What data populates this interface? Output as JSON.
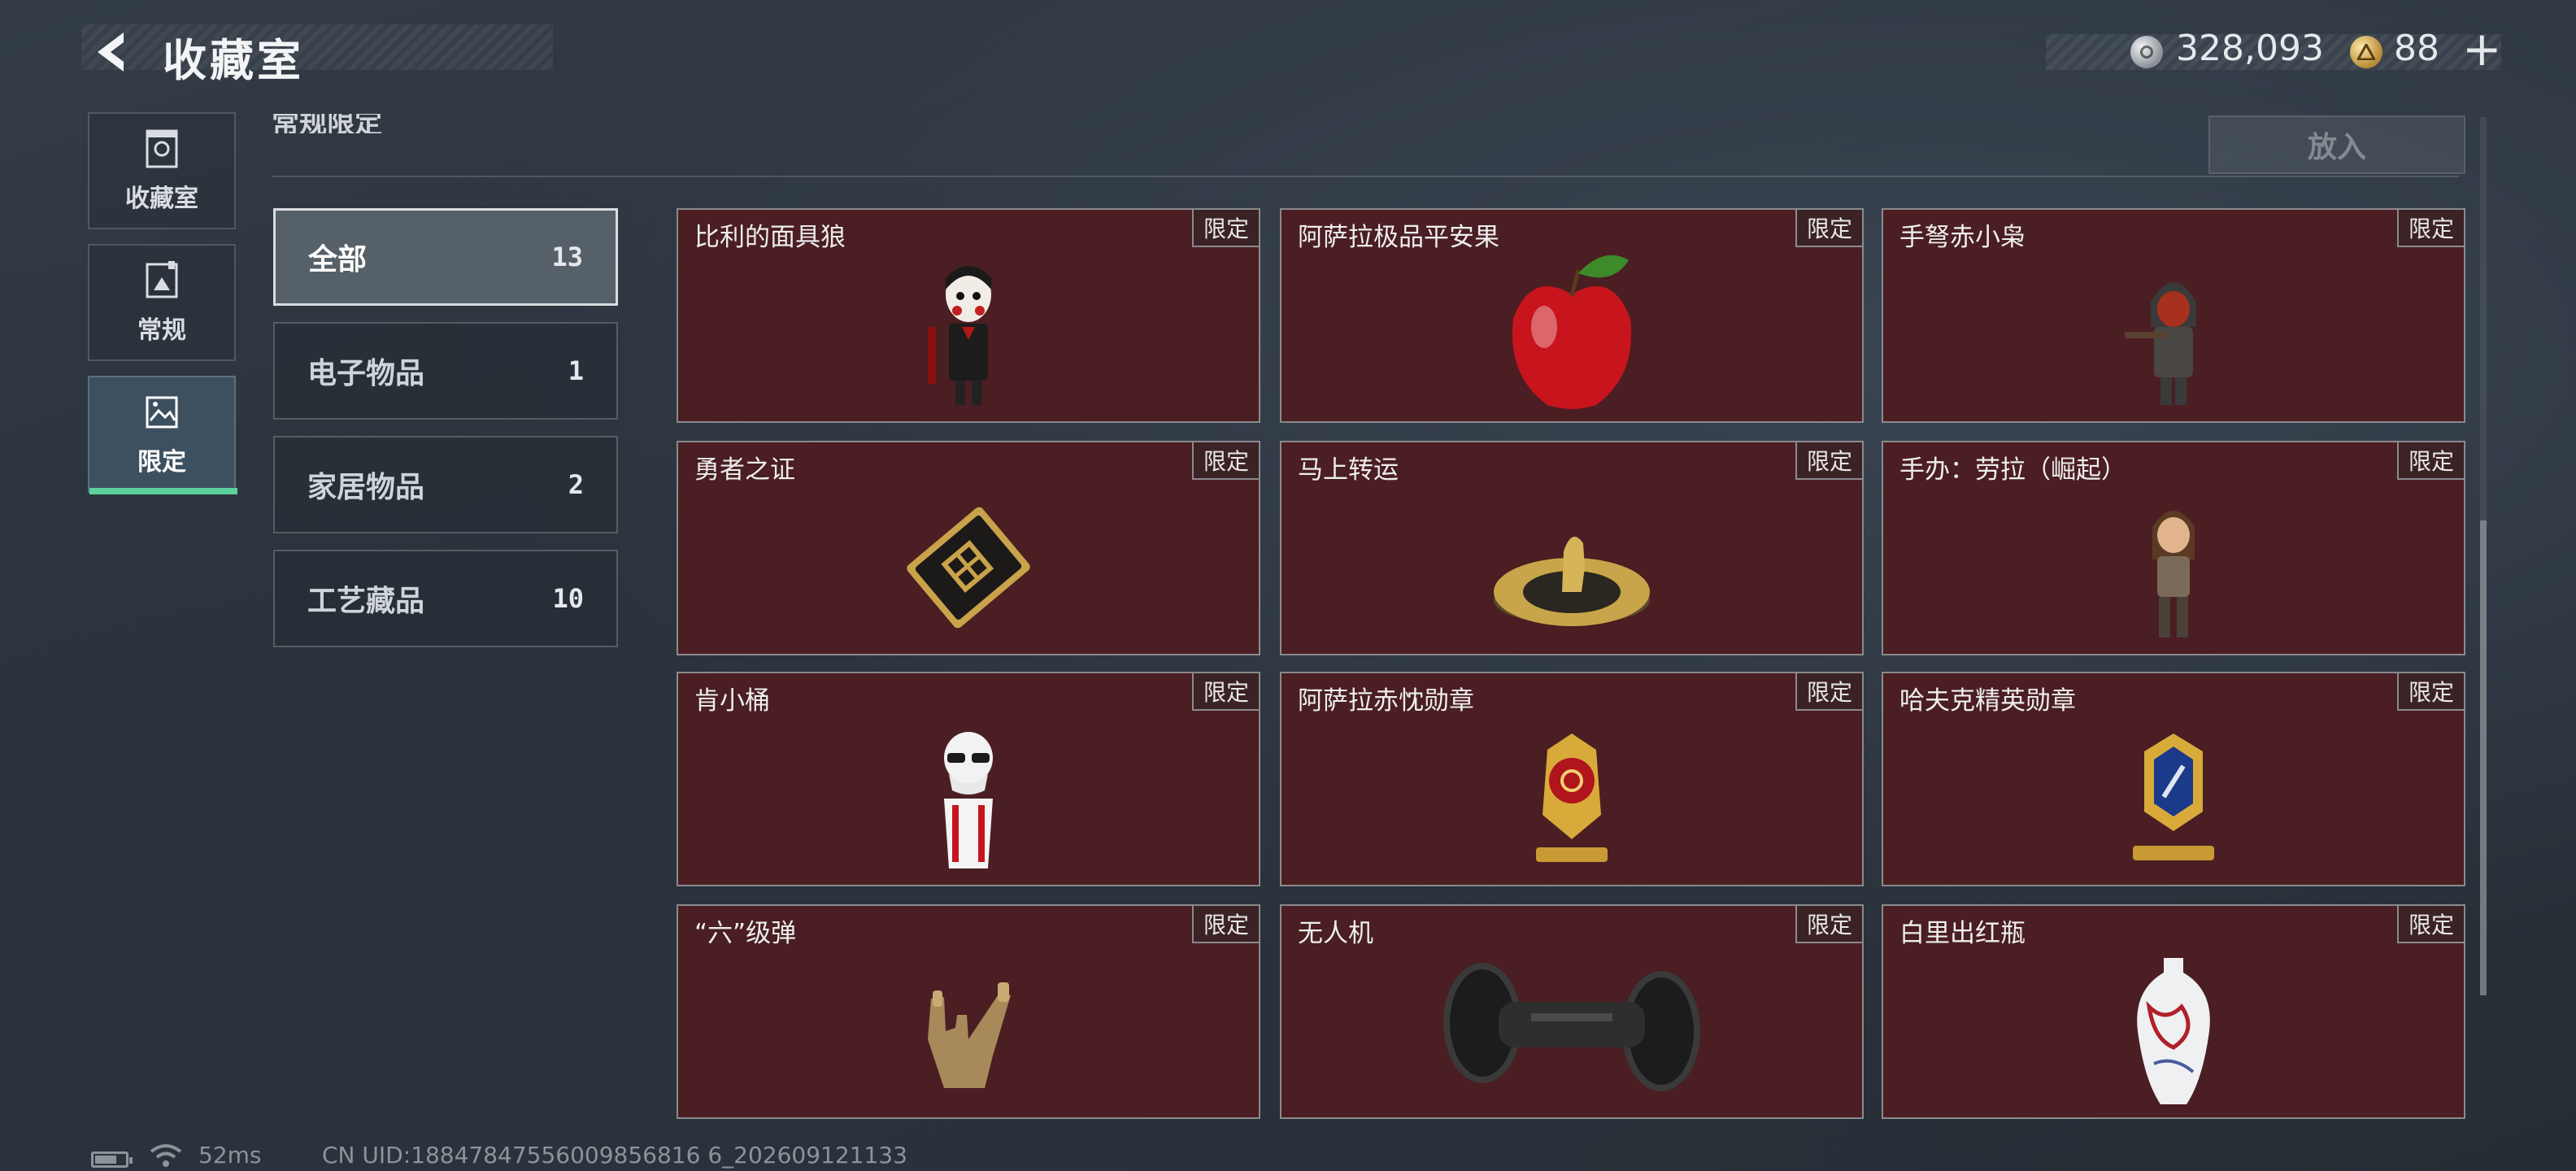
{
  "header": {
    "title": "收藏室",
    "silver_amount": "328,093",
    "gold_amount": "88",
    "plus_label": "+"
  },
  "nav": {
    "items": [
      {
        "label": "收藏室",
        "icon": "vault-door-icon"
      },
      {
        "label": "常规",
        "icon": "photo-frame-icon"
      },
      {
        "label": "限定",
        "icon": "limited-picture-icon",
        "active": true
      }
    ]
  },
  "section": {
    "heading": "常规限定",
    "put_label": "放入"
  },
  "categories": [
    {
      "label": "全部",
      "count": "13",
      "active": true
    },
    {
      "label": "电子物品",
      "count": "1"
    },
    {
      "label": "家居物品",
      "count": "2"
    },
    {
      "label": "工艺藏品",
      "count": "10"
    }
  ],
  "items": [
    {
      "name": "比利的面具狼",
      "badge": "限定",
      "icon": "puppet-figure-icon"
    },
    {
      "name": "阿萨拉极品平安果",
      "badge": "限定",
      "icon": "red-apple-icon"
    },
    {
      "name": "手弩赤小枭",
      "badge": "限定",
      "icon": "hooded-figure-icon"
    },
    {
      "name": "勇者之证",
      "badge": "限定",
      "icon": "gold-card-icon"
    },
    {
      "name": "马上转运",
      "badge": "限定",
      "icon": "horse-coin-disc-icon"
    },
    {
      "name": "手办：劳拉（崛起）",
      "badge": "限定",
      "icon": "lara-figure-icon"
    },
    {
      "name": "肯小桶",
      "badge": "限定",
      "icon": "colonel-bust-icon"
    },
    {
      "name": "阿萨拉赤忱勋章",
      "badge": "限定",
      "icon": "red-medal-icon"
    },
    {
      "name": "哈夫克精英勋章",
      "badge": "限定",
      "icon": "blue-medal-icon"
    },
    {
      "name": "“六”级弹",
      "badge": "限定",
      "icon": "bullet-hand-icon"
    },
    {
      "name": "无人机",
      "badge": "限定",
      "icon": "drone-roller-icon"
    },
    {
      "name": "白里出红瓶",
      "badge": "限定",
      "icon": "porcelain-vase-icon"
    }
  ],
  "status": {
    "ping": "52ms",
    "uid": "CN UID:18847847556009856816 6_202609121133"
  },
  "colors": {
    "accent": "#5ed29c",
    "card_bg": "#4a1e22",
    "card_border": "#8a8a8e"
  }
}
